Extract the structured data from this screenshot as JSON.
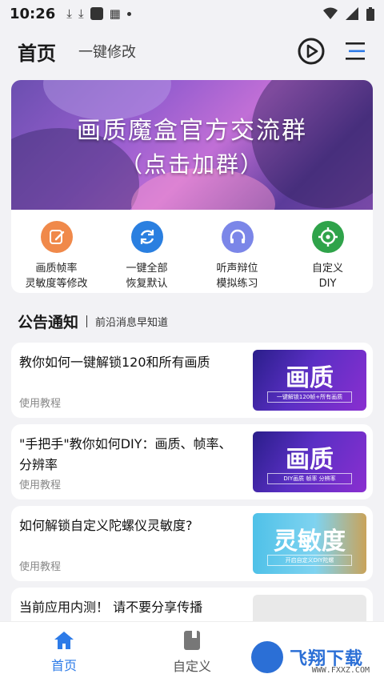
{
  "statusbar": {
    "time": "10:26"
  },
  "header": {
    "title": "首页",
    "subtitle": "一键修改"
  },
  "banner": {
    "line1": "画质魔盒官方交流群",
    "line2": "（点击加群）"
  },
  "features": [
    {
      "label1": "画质帧率",
      "label2": "灵敏度等修改",
      "icon": "edit-icon",
      "color": "#f0894a"
    },
    {
      "label1": "一键全部",
      "label2": "恢复默认",
      "icon": "refresh-icon",
      "color": "#2a7fe0"
    },
    {
      "label1": "听声辩位",
      "label2": "模拟练习",
      "icon": "headphones-icon",
      "color": "#7b86e8"
    },
    {
      "label1": "自定义",
      "label2": "DIY",
      "icon": "crosshair-icon",
      "color": "#2fa34a"
    }
  ],
  "section": {
    "title": "公告通知",
    "subtitle": "前沿消息早知道"
  },
  "articles": [
    {
      "title": "教你如何一键解锁120和所有画质",
      "tag": "使用教程",
      "thumb_big": "画质",
      "thumb_small": "一键解锁120帧+所有画质"
    },
    {
      "title": "\"手把手\"教你如何DIY：画质、帧率、分辨率",
      "tag": "使用教程",
      "thumb_big": "画质",
      "thumb_small": "DIY画质  帧率  分辨率"
    },
    {
      "title": "如何解锁自定义陀螺仪灵敏度?",
      "tag": "使用教程",
      "thumb_big": "灵敏度",
      "thumb_small": "开启自定义DIY陀螺"
    },
    {
      "title": "当前应用内测！ 请不要分享传播",
      "tag": "",
      "thumb_big": "",
      "thumb_small": ""
    }
  ],
  "tabs": [
    {
      "label": "首页",
      "icon": "home-icon"
    },
    {
      "label": "自定义",
      "icon": "book-icon"
    }
  ],
  "watermark": {
    "name": "飞翔下载",
    "url": "WWW.FXXZ.COM"
  },
  "colors": {
    "accent": "#2d7be8",
    "background": "#f2f2f5"
  }
}
